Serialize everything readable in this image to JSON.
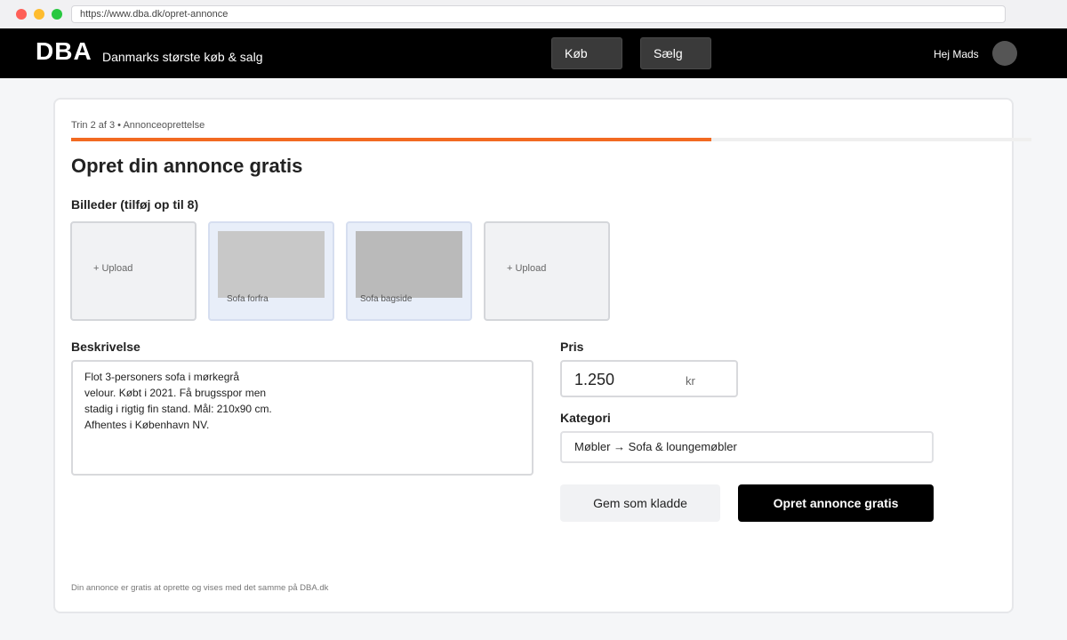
{
  "browser": {
    "url": "https://www.dba.dk/opret-annonce"
  },
  "header": {
    "logo": "DBA",
    "tagline": "Danmarks største køb & salg",
    "nav": {
      "buy_label": "Køb",
      "sell_label": "Sælg"
    },
    "greeting": "Hej Mads"
  },
  "form": {
    "step_text": "Trin 2 af 3 • Annonceoprettelse",
    "progress_fraction": 0.6667,
    "title": "Opret din annonce gratis",
    "images": {
      "label": "Billeder (tilføj op til 8)",
      "tiles": [
        {
          "type": "upload",
          "text": "+ Upload"
        },
        {
          "type": "photo",
          "caption": "Sofa forfra"
        },
        {
          "type": "photo",
          "caption": "Sofa bagside"
        },
        {
          "type": "upload",
          "text": "+ Upload"
        }
      ]
    },
    "description": {
      "label": "Beskrivelse",
      "lines": [
        "Flot 3-personers sofa i mørkegrå",
        "velour. Købt i 2021. Få brugsspor men",
        "stadig i rigtig fin stand. Mål: 210x90 cm.",
        "Afhentes i København NV."
      ]
    },
    "price": {
      "label": "Pris",
      "value": "1.250",
      "unit": "kr"
    },
    "category": {
      "label": "Kategori",
      "value": "Møbler → Sofa & loungemøbler"
    },
    "buttons": {
      "draft_label": "Gem som kladde",
      "submit_label": "Opret annonce gratis"
    },
    "footnote": "Din annonce er gratis at oprette og vises med det samme på DBA.dk"
  },
  "colors": {
    "accent": "#f26a21",
    "header_bg": "#000000",
    "primary_button": "#000000"
  }
}
